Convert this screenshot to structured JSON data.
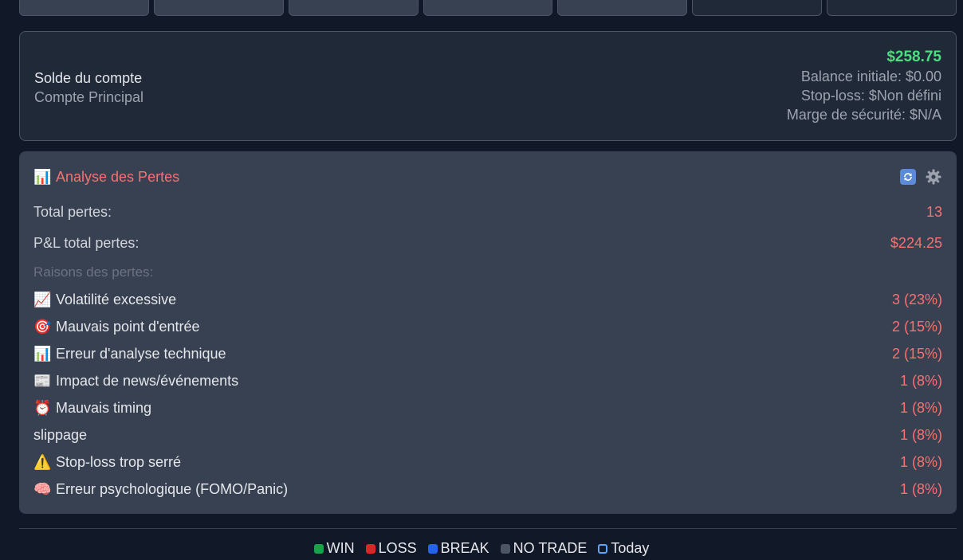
{
  "balance": {
    "title": "Solde du compte",
    "account_name": "Compte Principal",
    "amount": "$258.75",
    "initial_balance": "Balance initiale: $0.00",
    "stop_loss": "Stop-loss: $Non défini",
    "safety_margin": "Marge de sécurité: $N/A"
  },
  "loss_analysis": {
    "title": "Analyse des Pertes",
    "title_icon": "chart-icon",
    "total_label": "Total pertes:",
    "total_value": "13",
    "pnl_label": "P&L total pertes:",
    "pnl_value": "$224.25",
    "reasons_label": "Raisons des pertes:",
    "reasons": [
      {
        "emoji": "📈",
        "icon": "chart-up-icon",
        "label": "Volatilité excessive",
        "value": "3 (23%)"
      },
      {
        "emoji": "🎯",
        "icon": "target-icon",
        "label": "Mauvais point d'entrée",
        "value": "2 (15%)"
      },
      {
        "emoji": "📊",
        "icon": "bar-chart-icon",
        "label": "Erreur d'analyse technique",
        "value": "2 (15%)"
      },
      {
        "emoji": "📰",
        "icon": "newspaper-icon",
        "label": "Impact de news/événements",
        "value": "1 (8%)"
      },
      {
        "emoji": "⏰",
        "icon": "alarm-clock-icon",
        "label": "Mauvais timing",
        "value": "1 (8%)"
      },
      {
        "emoji": "",
        "icon": "",
        "label": "slippage",
        "value": "1 (8%)"
      },
      {
        "emoji": "⚠️",
        "icon": "warning-icon",
        "label": "Stop-loss trop serré",
        "value": "1 (8%)"
      },
      {
        "emoji": "🧠",
        "icon": "brain-icon",
        "label": "Erreur psychologique (FOMO/Panic)",
        "value": "1 (8%)"
      }
    ]
  },
  "legend": [
    {
      "label": "WIN",
      "color": "#16a34a"
    },
    {
      "label": "LOSS",
      "color": "#dc2626"
    },
    {
      "label": "BREAK",
      "color": "#2563eb"
    },
    {
      "label": "NO TRADE",
      "color": "#4b5563"
    },
    {
      "label": "Today",
      "color": "#60a5fa"
    }
  ],
  "colors": {
    "positive": "#4ade80",
    "negative": "#f87171",
    "card_bg": "#374151",
    "page_bg": "#111827"
  }
}
